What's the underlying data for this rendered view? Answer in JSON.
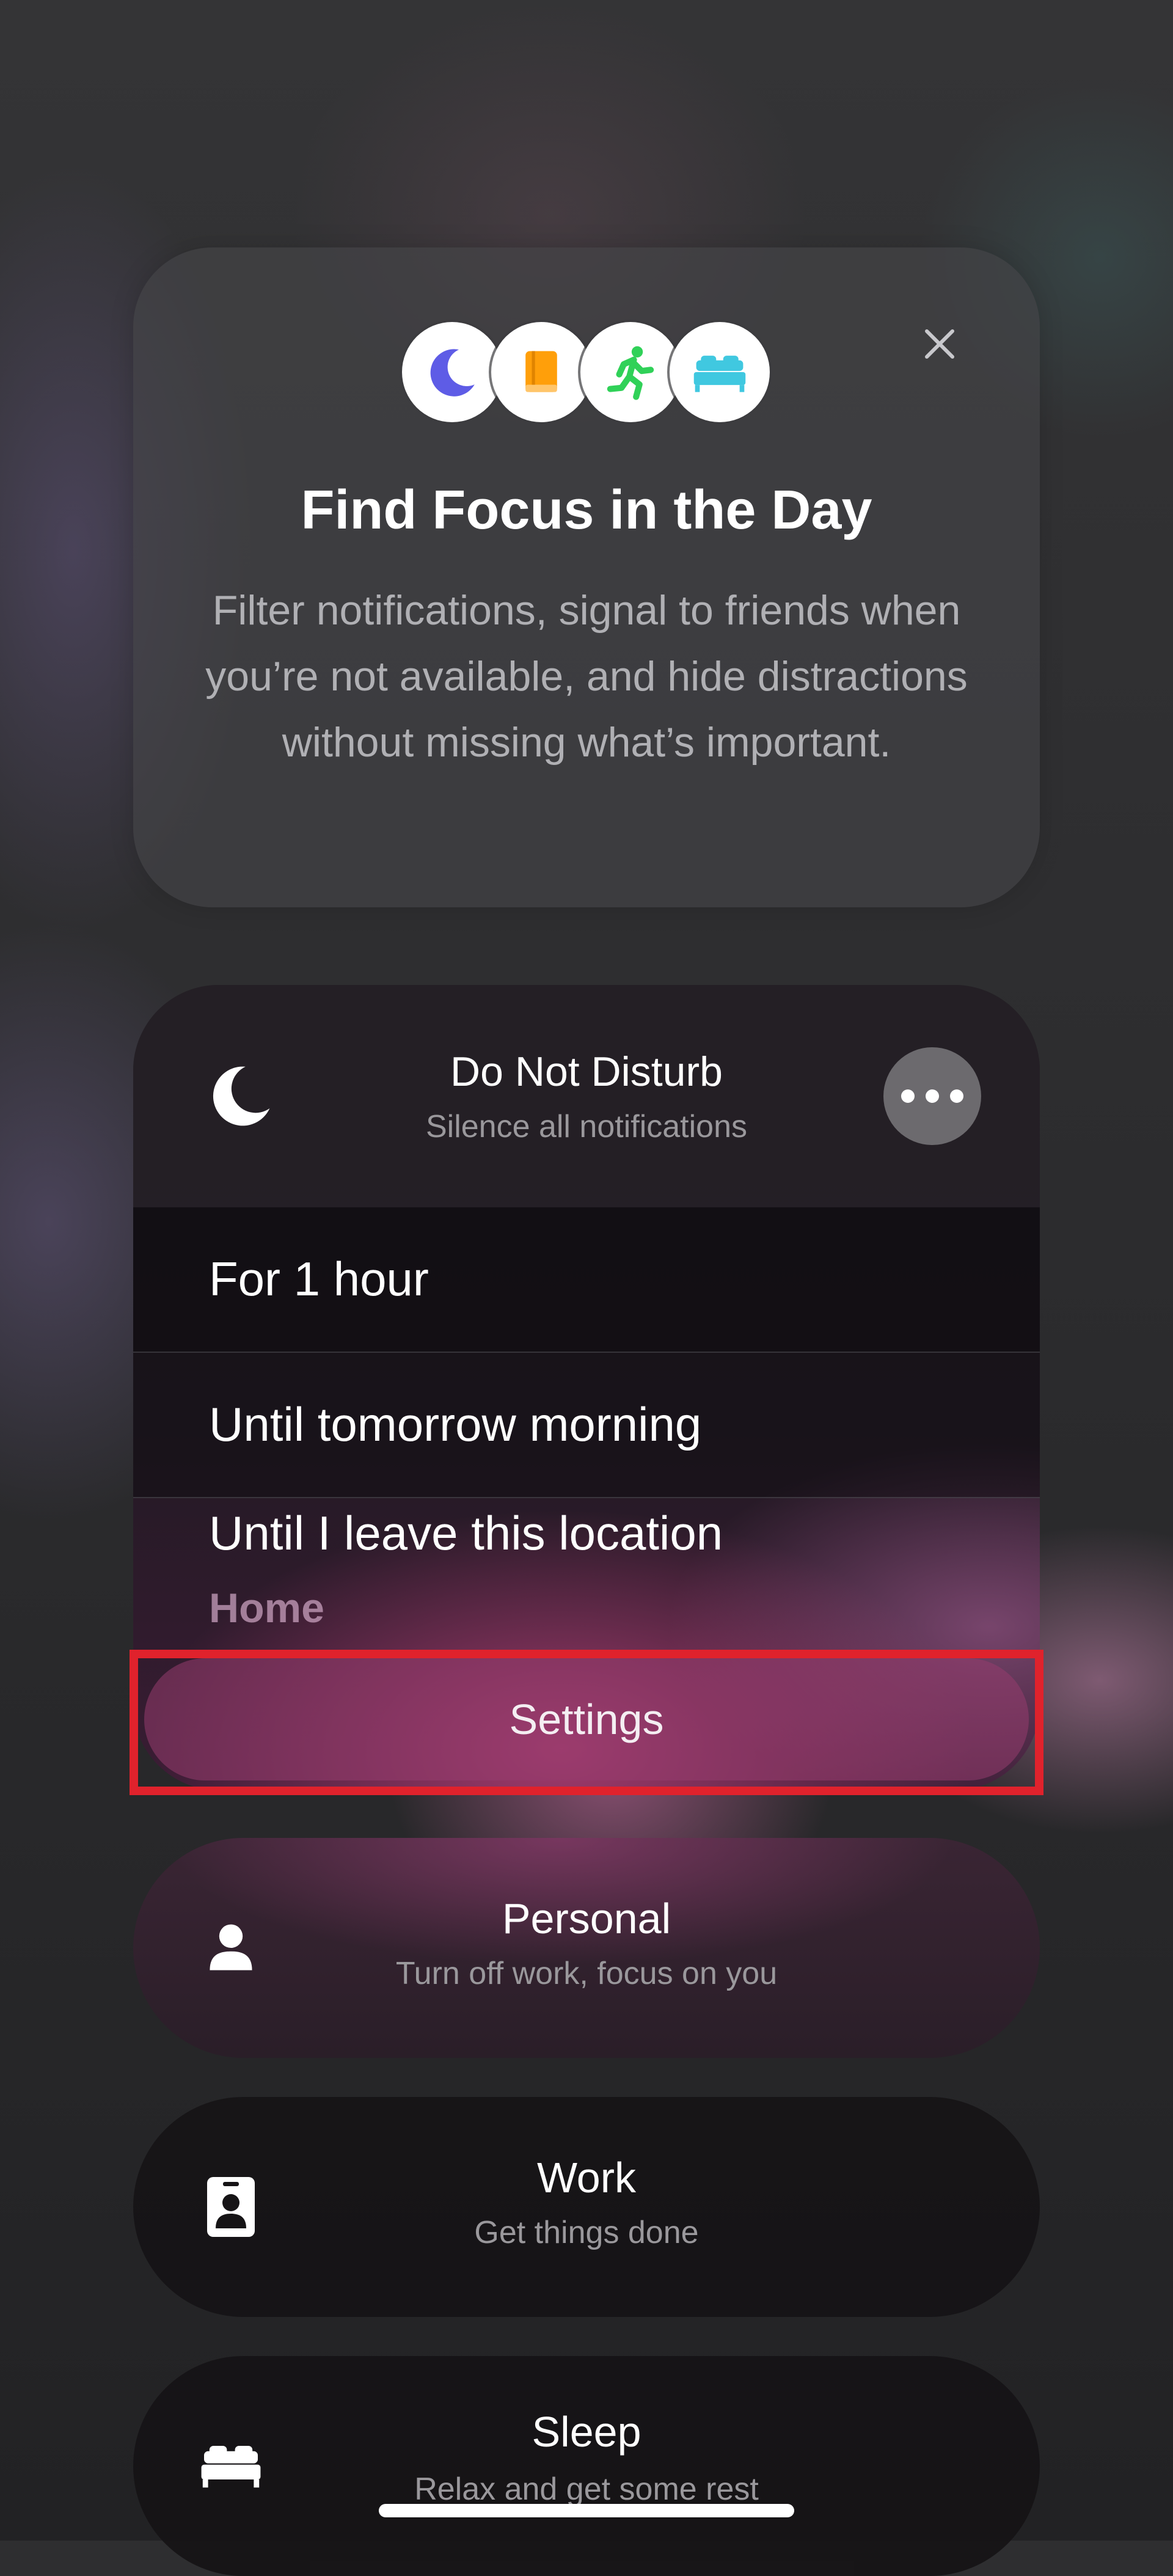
{
  "intro": {
    "title": "Find Focus in the Day",
    "description": "Filter notifications, signal to friends when you’re not available, and hide distractions without missing what’s important.",
    "icons": [
      "moon-icon",
      "book-icon",
      "running-figure-icon",
      "bed-icon"
    ],
    "icon_colors": {
      "moon": "#5e5ce6",
      "book": "#ff9f0a",
      "running": "#30d158",
      "bed": "#40c8e0"
    }
  },
  "do_not_disturb": {
    "title": "Do Not Disturb",
    "subtitle": "Silence all notifications",
    "options": [
      {
        "label": "For 1 hour"
      },
      {
        "label": "Until tomorrow morning"
      },
      {
        "label": "Until I leave this location",
        "sublabel": "Home"
      }
    ],
    "settings_label": "Settings",
    "highlight_color": "#e0222c"
  },
  "focus_modes": [
    {
      "title": "Personal",
      "subtitle": "Turn off work, focus on you",
      "icon": "person-icon"
    },
    {
      "title": "Work",
      "subtitle": "Get things done",
      "icon": "id-badge-icon"
    },
    {
      "title": "Sleep",
      "subtitle": "Relax and get some rest",
      "icon": "bed-icon"
    }
  ]
}
